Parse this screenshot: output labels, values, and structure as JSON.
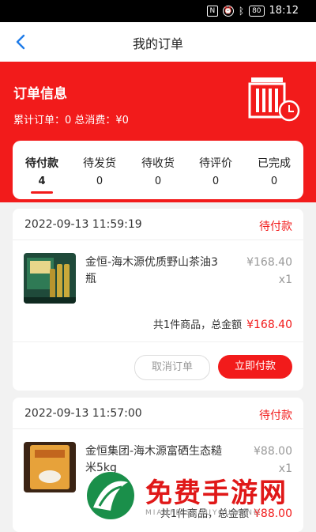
{
  "status_bar": {
    "battery": "80",
    "time": "18:12"
  },
  "nav": {
    "title": "我的订单"
  },
  "hero": {
    "title": "订单信息",
    "stats": "累计订单：0  总消费：¥0"
  },
  "tabs": [
    {
      "label": "待付款",
      "count": "4"
    },
    {
      "label": "待发货",
      "count": "0"
    },
    {
      "label": "待收货",
      "count": "0"
    },
    {
      "label": "待评价",
      "count": "0"
    },
    {
      "label": "已完成",
      "count": "0"
    }
  ],
  "orders": [
    {
      "date": "2022-09-13 11:59:19",
      "status": "待付款",
      "product": "金恒-海木源优质野山茶油3瓶",
      "price": "¥168.40",
      "qty": "x1",
      "summary": "共1件商品，总金额",
      "total": "¥168.40",
      "cancel_label": "取消订单",
      "pay_label": "立即付款"
    },
    {
      "date": "2022-09-13 11:57:00",
      "status": "待付款",
      "product": "金恒集团-海木源富硒生态糙米5kg",
      "price": "¥88.00",
      "qty": "x1",
      "summary": "共1件商品，总金额",
      "total": "¥88.00"
    }
  ],
  "watermark": {
    "text": "免费手游网",
    "sub": "MIANFEISHOUYOUWANG"
  },
  "colors": {
    "accent": "#f21b1b"
  }
}
